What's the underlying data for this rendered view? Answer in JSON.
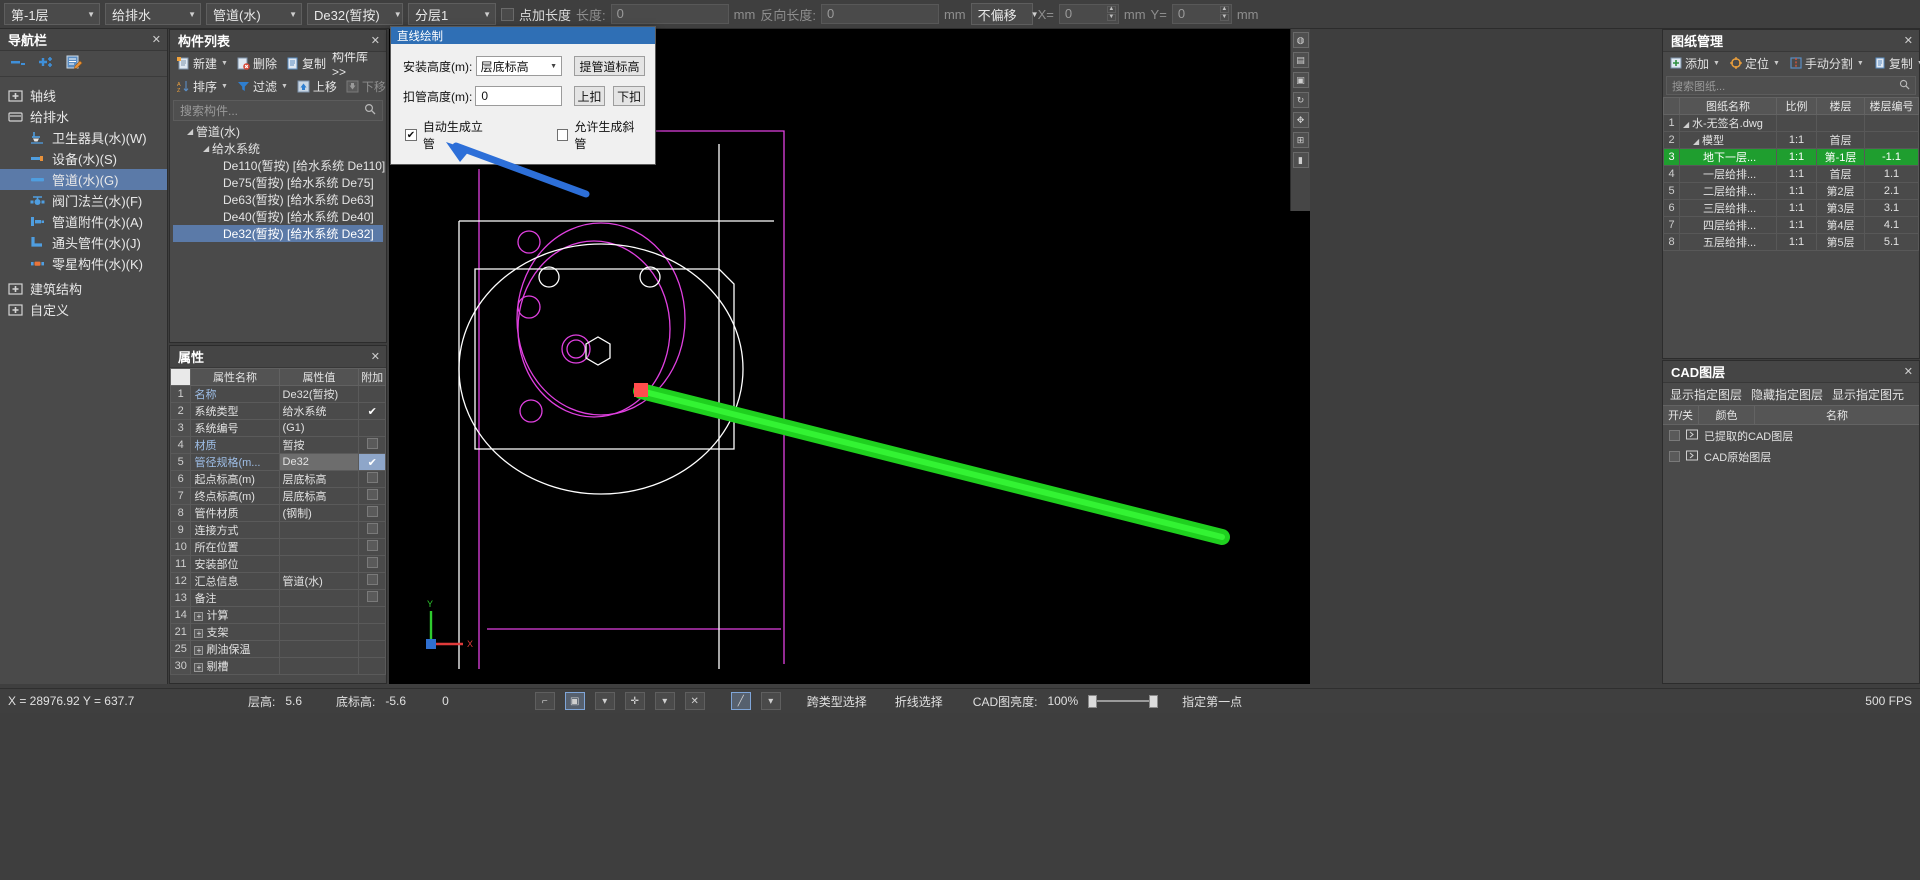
{
  "topbar": {
    "floor_select": "第-1层",
    "discipline_select": "给排水",
    "category_select": "管道(水)",
    "component_select": "De32(暂按)",
    "layer_select": "分层1",
    "add_length_label": "点加长度",
    "length_label": "长度:",
    "length_value": "0",
    "unit_mm": "mm",
    "reverse_length_label": "反向长度:",
    "reverse_length_value": "0",
    "offset_select": "不偏移",
    "x_label": "X=",
    "x_value": "0",
    "y_label": "Y=",
    "y_value": "0"
  },
  "nav": {
    "title": "导航栏",
    "tools": [
      "minus-icon",
      "plus-icon",
      "edit-icon"
    ],
    "items": [
      {
        "label": "轴线",
        "level": 1,
        "icon": "folder-plus-icon",
        "selected": false
      },
      {
        "label": "给排水",
        "level": 1,
        "icon": "folder-open-icon",
        "selected": false
      },
      {
        "label": "卫生器具(水)(W)",
        "level": 2,
        "icon": "sanitary-icon",
        "selected": false
      },
      {
        "label": "设备(水)(S)",
        "level": 2,
        "icon": "equipment-icon",
        "selected": false
      },
      {
        "label": "管道(水)(G)",
        "level": 2,
        "icon": "pipe-icon",
        "selected": true
      },
      {
        "label": "阀门法兰(水)(F)",
        "level": 2,
        "icon": "valve-icon",
        "selected": false
      },
      {
        "label": "管道附件(水)(A)",
        "level": 2,
        "icon": "accessory-icon",
        "selected": false
      },
      {
        "label": "通头管件(水)(J)",
        "level": 2,
        "icon": "elbow-icon",
        "selected": false
      },
      {
        "label": "零星构件(水)(K)",
        "level": 2,
        "icon": "misc-icon",
        "selected": false
      },
      {
        "label": "建筑结构",
        "level": 1,
        "icon": "folder-plus-icon",
        "selected": false
      },
      {
        "label": "自定义",
        "level": 1,
        "icon": "folder-plus-icon",
        "selected": false
      }
    ]
  },
  "component_panel": {
    "title": "构件列表",
    "toolbar_row1": [
      {
        "label": "新建",
        "icon": "new-icon",
        "caret": true
      },
      {
        "label": "删除",
        "icon": "delete-icon",
        "caret": false
      },
      {
        "label": "复制",
        "icon": "copy-icon",
        "caret": false
      }
    ],
    "library_link": "构件库>>",
    "toolbar_row2": [
      {
        "label": "排序",
        "icon": "sort-icon",
        "caret": true
      },
      {
        "label": "过滤",
        "icon": "filter-icon",
        "caret": true
      },
      {
        "label": "上移",
        "icon": "up-icon",
        "caret": false
      },
      {
        "label": "下移",
        "icon": "down-icon",
        "caret": false
      }
    ],
    "search_placeholder": "搜索构件...",
    "tree": [
      {
        "label": "管道(水)",
        "level": 1,
        "expandable": true,
        "selected": false
      },
      {
        "label": "给水系统",
        "level": 2,
        "expandable": true,
        "selected": false
      },
      {
        "label": "De110(暂按) [给水系统 De110]",
        "level": 3,
        "expandable": false,
        "selected": false
      },
      {
        "label": "De75(暂按) [给水系统 De75]",
        "level": 3,
        "expandable": false,
        "selected": false
      },
      {
        "label": "De63(暂按) [给水系统 De63]",
        "level": 3,
        "expandable": false,
        "selected": false
      },
      {
        "label": "De40(暂按) [给水系统 De40]",
        "level": 3,
        "expandable": false,
        "selected": false
      },
      {
        "label": "De32(暂按) [给水系统 De32]",
        "level": 3,
        "expandable": false,
        "selected": true
      }
    ]
  },
  "properties": {
    "title": "属性",
    "headers": [
      "",
      "属性名称",
      "属性值",
      "附加"
    ],
    "rows": [
      {
        "idx": "1",
        "name": "名称",
        "value": "De32(暂按)",
        "attach": "",
        "blue": true,
        "group": false,
        "hl": false
      },
      {
        "idx": "2",
        "name": "系统类型",
        "value": "给水系统",
        "attach": "check",
        "blue": false,
        "group": false,
        "hl": false
      },
      {
        "idx": "3",
        "name": "系统编号",
        "value": "(G1)",
        "attach": "",
        "blue": false,
        "group": false,
        "hl": false
      },
      {
        "idx": "4",
        "name": "材质",
        "value": "暂按",
        "attach": "box",
        "blue": true,
        "group": false,
        "hl": false
      },
      {
        "idx": "5",
        "name": "管径规格(m...",
        "value": "De32",
        "attach": "check",
        "blue": true,
        "group": false,
        "hl": true
      },
      {
        "idx": "6",
        "name": "起点标高(m)",
        "value": "层底标高",
        "attach": "box",
        "blue": false,
        "group": false,
        "hl": false
      },
      {
        "idx": "7",
        "name": "终点标高(m)",
        "value": "层底标高",
        "attach": "box",
        "blue": false,
        "group": false,
        "hl": false
      },
      {
        "idx": "8",
        "name": "管件材质",
        "value": "(钢制)",
        "attach": "box",
        "blue": false,
        "group": false,
        "hl": false
      },
      {
        "idx": "9",
        "name": "连接方式",
        "value": "",
        "attach": "box",
        "blue": false,
        "group": false,
        "hl": false
      },
      {
        "idx": "10",
        "name": "所在位置",
        "value": "",
        "attach": "box",
        "blue": false,
        "group": false,
        "hl": false
      },
      {
        "idx": "11",
        "name": "安装部位",
        "value": "",
        "attach": "box",
        "blue": false,
        "group": false,
        "hl": false
      },
      {
        "idx": "12",
        "name": "汇总信息",
        "value": "管道(水)",
        "attach": "box",
        "blue": false,
        "group": false,
        "hl": false
      },
      {
        "idx": "13",
        "name": "备注",
        "value": "",
        "attach": "box",
        "blue": false,
        "group": false,
        "hl": false
      },
      {
        "idx": "14",
        "name": "计算",
        "value": "",
        "attach": "",
        "blue": false,
        "group": true,
        "hl": false
      },
      {
        "idx": "21",
        "name": "支架",
        "value": "",
        "attach": "",
        "blue": false,
        "group": true,
        "hl": false
      },
      {
        "idx": "25",
        "name": "刷油保温",
        "value": "",
        "attach": "",
        "blue": false,
        "group": true,
        "hl": false
      },
      {
        "idx": "30",
        "name": "剔槽",
        "value": "",
        "attach": "",
        "blue": false,
        "group": true,
        "hl": false
      }
    ]
  },
  "dialog": {
    "title": "直线绘制",
    "install_height_label": "安装高度(m):",
    "install_height_value": "层底标高",
    "lift_pipe_button": "提管道标高",
    "deduct_height_label": "扣管高度(m):",
    "deduct_height_value": "0",
    "up_button": "上扣",
    "down_button": "下扣",
    "auto_riser_label": "自动生成立管",
    "auto_riser_checked": true,
    "allow_slope_label": "允许生成斜管",
    "allow_slope_checked": false
  },
  "drawing_manager": {
    "title": "图纸管理",
    "toolbar": [
      {
        "label": "添加",
        "icon": "add-icon",
        "caret": true
      },
      {
        "label": "定位",
        "icon": "locate-icon",
        "caret": true
      },
      {
        "label": "手动分割",
        "icon": "split-icon",
        "caret": true
      },
      {
        "label": "复制",
        "icon": "copy-icon",
        "caret": true
      }
    ],
    "search_placeholder": "搜索图纸...",
    "headers": [
      "",
      "图纸名称",
      "比例",
      "楼层",
      "楼层编号"
    ],
    "rows": [
      {
        "idx": "1",
        "name": "水-无签名.dwg",
        "scale": "",
        "floor": "",
        "floor_no": "",
        "level": 0,
        "selected": false
      },
      {
        "idx": "2",
        "name": "模型",
        "scale": "1:1",
        "floor": "首层",
        "floor_no": "",
        "level": 1,
        "selected": false
      },
      {
        "idx": "3",
        "name": "地下一层...",
        "scale": "1:1",
        "floor": "第-1层",
        "floor_no": "-1.1",
        "level": 2,
        "selected": true
      },
      {
        "idx": "4",
        "name": "一层给排...",
        "scale": "1:1",
        "floor": "首层",
        "floor_no": "1.1",
        "level": 2,
        "selected": false
      },
      {
        "idx": "5",
        "name": "二层给排...",
        "scale": "1:1",
        "floor": "第2层",
        "floor_no": "2.1",
        "level": 2,
        "selected": false
      },
      {
        "idx": "6",
        "name": "三层给排...",
        "scale": "1:1",
        "floor": "第3层",
        "floor_no": "3.1",
        "level": 2,
        "selected": false
      },
      {
        "idx": "7",
        "name": "四层给排...",
        "scale": "1:1",
        "floor": "第4层",
        "floor_no": "4.1",
        "level": 2,
        "selected": false
      },
      {
        "idx": "8",
        "name": "五层给排...",
        "scale": "1:1",
        "floor": "第5层",
        "floor_no": "5.1",
        "level": 2,
        "selected": false
      }
    ]
  },
  "cad_layers": {
    "title": "CAD图层",
    "links": [
      "显示指定图层",
      "隐藏指定图层",
      "显示指定图元"
    ],
    "headers": [
      "开/关",
      "颜色",
      "名称"
    ],
    "rows": [
      {
        "name": "已提取的CAD图层",
        "checked": false
      },
      {
        "name": "CAD原始图层",
        "checked": false
      }
    ]
  },
  "statusbar": {
    "coords": "X = 28976.92 Y = 637.7",
    "floor_height_label": "层高:",
    "floor_height_value": "5.6",
    "base_elev_label": "底标高:",
    "base_elev_value": "-5.6",
    "extra_value": "0",
    "cross_select": "跨类型选择",
    "polyline_select": "折线选择",
    "cad_brightness_label": "CAD图亮度:",
    "cad_brightness_value": "100%",
    "hint": "指定第一点",
    "fps": "500 FPS"
  }
}
